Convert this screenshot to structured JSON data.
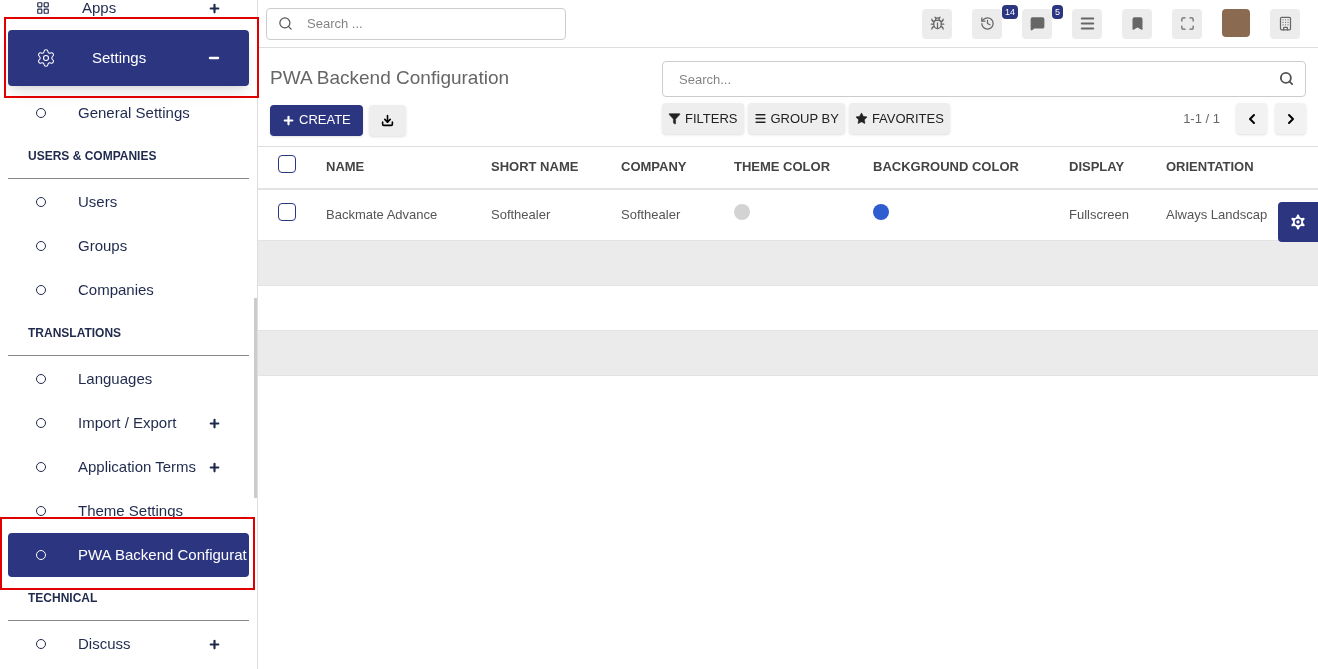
{
  "sidebar": {
    "items": [
      {
        "kind": "app",
        "label": "Apps",
        "expanded": false,
        "selected": false,
        "highlighted": false
      },
      {
        "kind": "menu",
        "label": "Settings",
        "expanded": true,
        "selected": true,
        "highlighted": true
      },
      {
        "kind": "link",
        "label": "General Settings",
        "selected": false,
        "highlighted": false
      },
      {
        "kind": "section",
        "label": "USERS & COMPANIES"
      },
      {
        "kind": "link",
        "label": "Users",
        "selected": false,
        "highlighted": false
      },
      {
        "kind": "link",
        "label": "Groups",
        "selected": false,
        "highlighted": false
      },
      {
        "kind": "link",
        "label": "Companies",
        "selected": false,
        "highlighted": false
      },
      {
        "kind": "section",
        "label": "TRANSLATIONS"
      },
      {
        "kind": "link",
        "label": "Languages",
        "selected": false,
        "highlighted": false
      },
      {
        "kind": "group",
        "label": "Import / Export",
        "expanded": false,
        "selected": false,
        "highlighted": false
      },
      {
        "kind": "group",
        "label": "Application Terms",
        "expanded": false,
        "selected": false,
        "highlighted": false
      },
      {
        "kind": "link",
        "label": "Theme Settings",
        "selected": false,
        "highlighted": false
      },
      {
        "kind": "link",
        "label": "PWA Backend Configurat",
        "selected": true,
        "highlighted": true
      },
      {
        "kind": "section",
        "label": "TECHNICAL"
      },
      {
        "kind": "group",
        "label": "Discuss",
        "expanded": false,
        "selected": false,
        "highlighted": false
      }
    ]
  },
  "topbar": {
    "search_placeholder": "Search ...",
    "activity_count": "14",
    "message_count": "5"
  },
  "control_panel": {
    "title": "PWA Backend Configuration",
    "create_label": "CREATE",
    "search_placeholder": "Search...",
    "filters": [
      "FILTERS",
      "GROUP BY",
      "FAVORITES"
    ],
    "pager": "1-1 / 1"
  },
  "table": {
    "header_checked": false,
    "columns": [
      "NAME",
      "SHORT NAME",
      "COMPANY",
      "THEME COLOR",
      "BACKGROUND COLOR",
      "DISPLAY",
      "ORIENTATION"
    ],
    "rows": [
      {
        "checked": false,
        "name": "Backmate Advance",
        "short_name": "Softhealer",
        "company": "Softhealer",
        "theme_color": {
          "color": "#d3d3d3"
        },
        "background_color": {
          "color": "#2f5dd0"
        },
        "display": "Fullscreen",
        "orientation": "Always Landscap"
      }
    ]
  }
}
